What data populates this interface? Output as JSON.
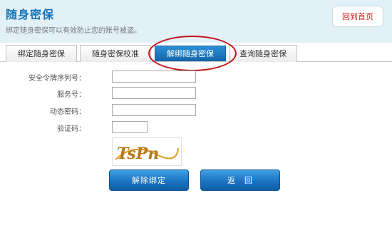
{
  "header": {
    "title": "随身密保",
    "subtitle": "绑定随身密保可以有效防止您的账号被盗。",
    "home_button": "回到首页"
  },
  "tabs": [
    {
      "label": "绑定随身密保",
      "active": false
    },
    {
      "label": "随身密保校准",
      "active": false
    },
    {
      "label": "解绑随身密保",
      "active": true
    },
    {
      "label": "查询随身密保",
      "active": false
    }
  ],
  "form": {
    "token_serial_label": "安全令牌序列号：",
    "token_serial_value": "",
    "server_label": "服务号：",
    "server_value": "",
    "dynamic_pwd_label": "动态密码：",
    "dynamic_pwd_value": "",
    "captcha_label": "验证码：",
    "captcha_value": "",
    "captcha_image_text": "TsPn"
  },
  "buttons": {
    "unbind": "解除绑定",
    "back": "返　回"
  },
  "colors": {
    "accent": "#1572b6",
    "button": "#1b74c2",
    "highlight_circle": "#c0151b",
    "header_bg": "#e2f1f8"
  }
}
